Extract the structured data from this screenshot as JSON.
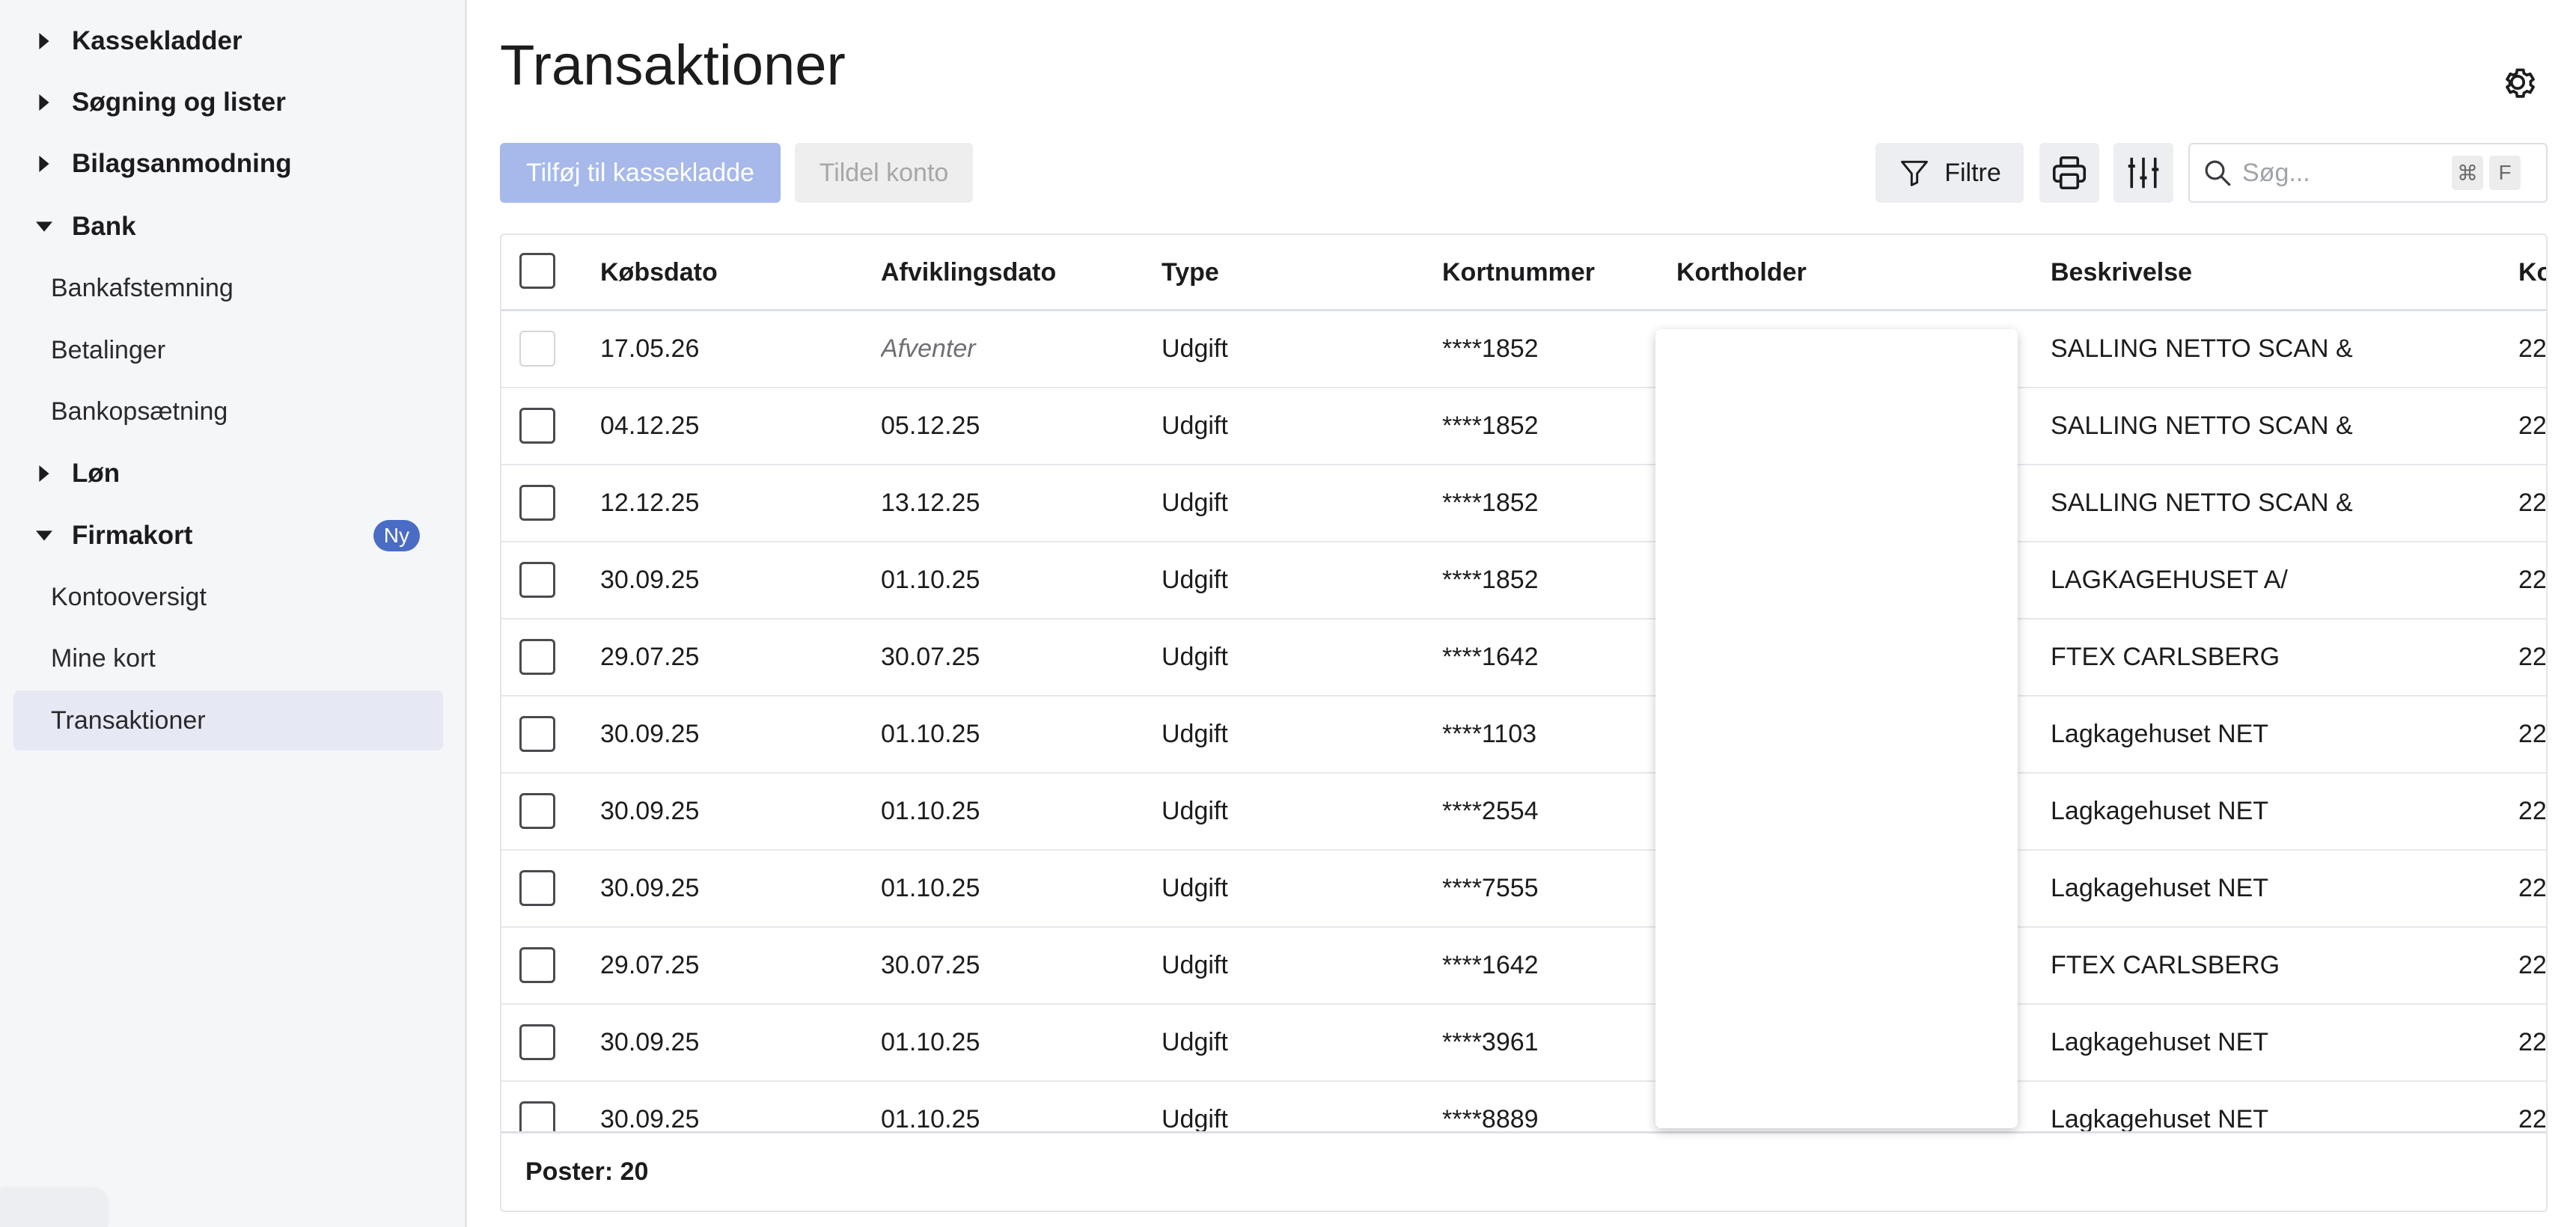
{
  "sidebar": {
    "groups": [
      {
        "label": "Kassekladder",
        "expanded": false
      },
      {
        "label": "Søgning og lister",
        "expanded": false
      },
      {
        "label": "Bilagsanmodning",
        "expanded": false
      },
      {
        "label": "Bank",
        "expanded": true,
        "items": [
          "Bankafstemning",
          "Betalinger",
          "Bankopsætning"
        ]
      },
      {
        "label": "Løn",
        "expanded": false
      },
      {
        "label": "Firmakort",
        "expanded": true,
        "badge": "Ny",
        "items": [
          "Kontooversigt",
          "Mine kort",
          "Transaktioner"
        ]
      }
    ],
    "active_item": "Transaktioner"
  },
  "page": {
    "title": "Transaktioner",
    "settings_icon": "gear-icon"
  },
  "toolbar": {
    "add_to_journal_label": "Tilføj til kassekladde",
    "assign_account_label": "Tildel konto",
    "filter_label": "Filtre",
    "filter_icon": "filter-funnel-icon",
    "print_icon": "printer-icon",
    "columns_icon": "sliders-icon",
    "search_placeholder": "Søg...",
    "search_shortcut": [
      "⌘",
      "F"
    ]
  },
  "table": {
    "columns": [
      "Købsdato",
      "Afviklingsdato",
      "Type",
      "Kortnummer",
      "Kortholder",
      "Beskrivelse",
      "Ko"
    ],
    "rows": [
      {
        "purchase_date": "17.05.26",
        "settlement_date": "Afventer",
        "type": "Udgift",
        "card": "****1852",
        "holder": "",
        "description": "SALLING NETTO SCAN &",
        "extra": "22"
      },
      {
        "purchase_date": "04.12.25",
        "settlement_date": "05.12.25",
        "type": "Udgift",
        "card": "****1852",
        "holder": "",
        "description": "SALLING NETTO SCAN &",
        "extra": "22"
      },
      {
        "purchase_date": "12.12.25",
        "settlement_date": "13.12.25",
        "type": "Udgift",
        "card": "****1852",
        "holder": "",
        "description": "SALLING NETTO SCAN &",
        "extra": "22"
      },
      {
        "purchase_date": "30.09.25",
        "settlement_date": "01.10.25",
        "type": "Udgift",
        "card": "****1852",
        "holder": "",
        "description": "LAGKAGEHUSET A/",
        "extra": "22"
      },
      {
        "purchase_date": "29.07.25",
        "settlement_date": "30.07.25",
        "type": "Udgift",
        "card": "****1642",
        "holder": "",
        "description": "FTEX CARLSBERG",
        "extra": "22"
      },
      {
        "purchase_date": "30.09.25",
        "settlement_date": "01.10.25",
        "type": "Udgift",
        "card": "****1103",
        "holder": "",
        "description": "Lagkagehuset NET",
        "extra": "22"
      },
      {
        "purchase_date": "30.09.25",
        "settlement_date": "01.10.25",
        "type": "Udgift",
        "card": "****2554",
        "holder": "",
        "description": "Lagkagehuset NET",
        "extra": "22"
      },
      {
        "purchase_date": "30.09.25",
        "settlement_date": "01.10.25",
        "type": "Udgift",
        "card": "****7555",
        "holder": "",
        "description": "Lagkagehuset NET",
        "extra": "22"
      },
      {
        "purchase_date": "29.07.25",
        "settlement_date": "30.07.25",
        "type": "Udgift",
        "card": "****1642",
        "holder": "",
        "description": "FTEX CARLSBERG",
        "extra": "22"
      },
      {
        "purchase_date": "30.09.25",
        "settlement_date": "01.10.25",
        "type": "Udgift",
        "card": "****3961",
        "holder": "",
        "description": "Lagkagehuset NET",
        "extra": "22"
      },
      {
        "purchase_date": "30.09.25",
        "settlement_date": "01.10.25",
        "type": "Udgift",
        "card": "****8889",
        "holder": "",
        "description": "Lagkagehuset NET",
        "extra": "22"
      }
    ],
    "footer_label": "Poster: 20"
  },
  "colors": {
    "primary_button": "#a6b9ea",
    "badge": "#4a6cc4",
    "active_nav": "#e6e9f4"
  }
}
